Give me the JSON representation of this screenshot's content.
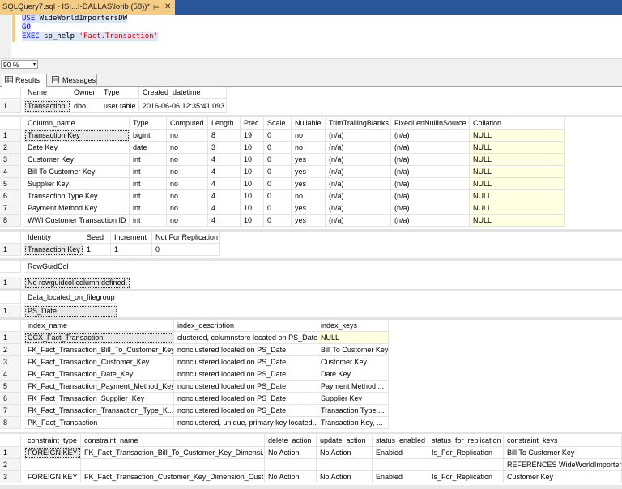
{
  "tab": {
    "title": "SQLQuery7.sql - ISI...I-DALLAS\\lorib (58))*",
    "pin": "⊨",
    "close": "✕"
  },
  "code": {
    "line1_kw": "USE",
    "line1_rest": " WideWorldImportersDW",
    "line2_kw": "GO",
    "line3_kw": "EXEC",
    "line3_proc": " sp_help ",
    "line3_str": "'Fact.Transaction'"
  },
  "zoom": {
    "value": "90 %",
    "arrow": "▾"
  },
  "result_tabs": [
    {
      "label": "Results"
    },
    {
      "label": "Messages"
    }
  ],
  "grid1": {
    "headers": [
      "Name",
      "Owner",
      "Type",
      "Created_datetime"
    ],
    "rows": [
      {
        "n": "1",
        "c": [
          "Transaction",
          "dbo",
          "user table",
          "2016-06-06 12:35:41.093"
        ]
      }
    ]
  },
  "grid2": {
    "headers": [
      "Column_name",
      "Type",
      "Computed",
      "Length",
      "Prec",
      "Scale",
      "Nullable",
      "TrimTrailingBlanks",
      "FixedLenNullInSource",
      "Collation"
    ],
    "rows": [
      {
        "n": "1",
        "c": [
          "Transaction Key",
          "bigint",
          "no",
          "8",
          "19",
          "0",
          "no",
          "(n/a)",
          "(n/a)",
          "NULL"
        ]
      },
      {
        "n": "2",
        "c": [
          "Date Key",
          "date",
          "no",
          "3",
          "10",
          "0",
          "no",
          "(n/a)",
          "(n/a)",
          "NULL"
        ]
      },
      {
        "n": "3",
        "c": [
          "Customer Key",
          "int",
          "no",
          "4",
          "10",
          "0",
          "yes",
          "(n/a)",
          "(n/a)",
          "NULL"
        ]
      },
      {
        "n": "4",
        "c": [
          "Bill To Customer Key",
          "int",
          "no",
          "4",
          "10",
          "0",
          "yes",
          "(n/a)",
          "(n/a)",
          "NULL"
        ]
      },
      {
        "n": "5",
        "c": [
          "Supplier Key",
          "int",
          "no",
          "4",
          "10",
          "0",
          "yes",
          "(n/a)",
          "(n/a)",
          "NULL"
        ]
      },
      {
        "n": "6",
        "c": [
          "Transaction Type Key",
          "int",
          "no",
          "4",
          "10",
          "0",
          "no",
          "(n/a)",
          "(n/a)",
          "NULL"
        ]
      },
      {
        "n": "7",
        "c": [
          "Payment Method Key",
          "int",
          "no",
          "4",
          "10",
          "0",
          "yes",
          "(n/a)",
          "(n/a)",
          "NULL"
        ]
      },
      {
        "n": "8",
        "c": [
          "WWI Customer Transaction ID",
          "int",
          "no",
          "4",
          "10",
          "0",
          "yes",
          "(n/a)",
          "(n/a)",
          "NULL"
        ]
      }
    ]
  },
  "grid3": {
    "headers": [
      "Identity",
      "Seed",
      "Increment",
      "Not For Replication"
    ],
    "rows": [
      {
        "n": "1",
        "c": [
          "Transaction Key",
          "1",
          "1",
          "0"
        ]
      }
    ]
  },
  "grid4": {
    "headers": [
      "RowGuidCol"
    ],
    "rows": [
      {
        "n": "1",
        "c": [
          "No rowguidcol column defined."
        ]
      }
    ]
  },
  "grid5": {
    "headers": [
      "Data_located_on_filegroup"
    ],
    "rows": [
      {
        "n": "1",
        "c": [
          "PS_Date"
        ]
      }
    ]
  },
  "grid6": {
    "headers": [
      "index_name",
      "index_description",
      "index_keys"
    ],
    "rows": [
      {
        "n": "1",
        "c": [
          "CCX_Fact_Transaction",
          "clustered, columnstore located on PS_Date",
          "NULL"
        ]
      },
      {
        "n": "2",
        "c": [
          "FK_Fact_Transaction_Bill_To_Customer_Key",
          "nonclustered located on PS_Date",
          "Bill To Customer Key"
        ]
      },
      {
        "n": "3",
        "c": [
          "FK_Fact_Transaction_Customer_Key",
          "nonclustered located on PS_Date",
          "Customer Key"
        ]
      },
      {
        "n": "4",
        "c": [
          "FK_Fact_Transaction_Date_Key",
          "nonclustered located on PS_Date",
          "Date Key"
        ]
      },
      {
        "n": "5",
        "c": [
          "FK_Fact_Transaction_Payment_Method_Key",
          "nonclustered located on PS_Date",
          "Payment Method ..."
        ]
      },
      {
        "n": "6",
        "c": [
          "FK_Fact_Transaction_Supplier_Key",
          "nonclustered located on PS_Date",
          "Supplier Key"
        ]
      },
      {
        "n": "7",
        "c": [
          "FK_Fact_Transaction_Transaction_Type_K...",
          "nonclustered located on PS_Date",
          "Transaction Type ..."
        ]
      },
      {
        "n": "8",
        "c": [
          "PK_Fact_Transaction",
          "nonclustered, unique, primary key located...",
          "Transaction Key, ..."
        ]
      }
    ]
  },
  "grid7": {
    "headers": [
      "constraint_type",
      "constraint_name",
      "delete_action",
      "update_action",
      "status_enabled",
      "status_for_replication",
      "constraint_keys"
    ],
    "rows": [
      {
        "n": "1",
        "c": [
          "FOREIGN KEY",
          "FK_Fact_Transaction_Bill_To_Customer_Key_Dimensi...",
          "No Action",
          "No Action",
          "Enabled",
          "Is_For_Replication",
          "Bill To Customer Key"
        ]
      },
      {
        "n": "2",
        "c": [
          "",
          "",
          "",
          "",
          "",
          "",
          "REFERENCES WideWorldImportersD"
        ]
      },
      {
        "n": "3",
        "c": [
          "FOREIGN KEY",
          "FK_Fact_Transaction_Customer_Key_Dimension_Cust...",
          "No Action",
          "No Action",
          "Enabled",
          "Is_For_Replication",
          "Customer Key"
        ]
      }
    ]
  },
  "colors": {
    "tabstrip": "#2b579a",
    "active_tab": "#f5cc84",
    "null_bg": "#ffffe1"
  }
}
